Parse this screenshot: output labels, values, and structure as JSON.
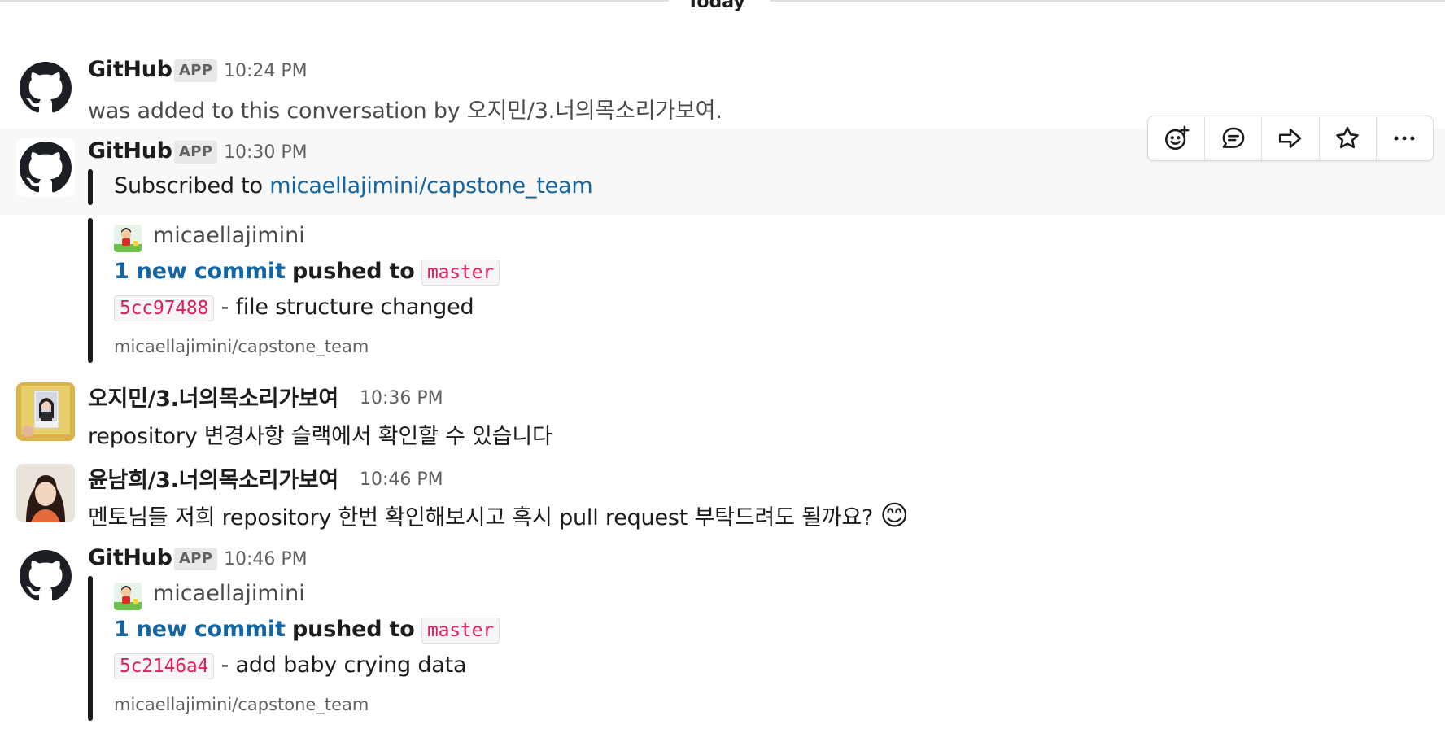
{
  "divider": {
    "label": "Today"
  },
  "messages": [
    {
      "author": "GitHub",
      "badge": "APP",
      "time": "10:24 PM",
      "text_prefix": "was added to this conversation by ",
      "text_user": "오지민/3.너의목소리가보여",
      "text_suffix": "."
    },
    {
      "author": "GitHub",
      "badge": "APP",
      "time": "10:30 PM",
      "subscribe_prefix": "Subscribed to ",
      "subscribe_link": "micaellajimini/capstone_team",
      "commit_author": "micaellajimini",
      "commit_count_link": "1 new commit",
      "pushed_to": "pushed to",
      "branch": "master",
      "sha": "5cc97488",
      "commit_message": "- file structure changed",
      "repo": "micaellajimini/capstone_team"
    },
    {
      "author": "오지민/3.너의목소리가보여",
      "time": "10:36 PM",
      "text": "repository 변경사항 슬랙에서 확인할 수 있습니다"
    },
    {
      "author": "윤남희/3.너의목소리가보여",
      "time": "10:46 PM",
      "text": "멘토님들 저희 repository 한번 확인해보시고 혹시 pull request 부탁드려도 될까요?",
      "emoji": "😊"
    },
    {
      "author": "GitHub",
      "badge": "APP",
      "time": "10:46 PM",
      "commit_author": "micaellajimini",
      "commit_count_link": "1 new commit",
      "pushed_to": "pushed to",
      "branch": "master",
      "sha": "5c2146a4",
      "commit_message": "- add baby crying data",
      "repo": "micaellajimini/capstone_team"
    }
  ],
  "toolbar": {
    "icons": [
      "add-reaction-icon",
      "reply-thread-icon",
      "share-message-icon",
      "save-star-icon",
      "more-actions-icon"
    ]
  },
  "colors": {
    "link": "#1264a3",
    "code": "#e01e5a",
    "hover_bg": "#f8f8f8"
  }
}
